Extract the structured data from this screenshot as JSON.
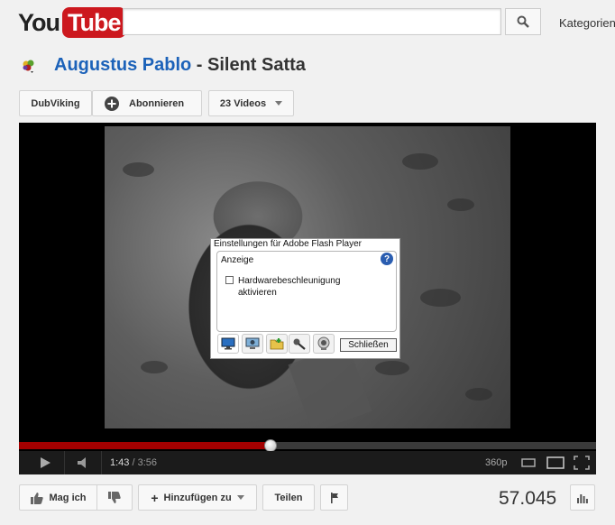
{
  "header": {
    "logo_you": "You",
    "logo_tube": "Tube",
    "search": {
      "value": "",
      "placeholder": ""
    },
    "categories_label": "Kategorien"
  },
  "video": {
    "artist": "Augustus Pablo",
    "separator": " - ",
    "song": "Silent Satta"
  },
  "channel": {
    "name_button": "DubViking",
    "subscribe_button": "Abonnieren",
    "videos_button": "23 Videos"
  },
  "player": {
    "current_time": "1:43",
    "time_separator": " / ",
    "duration": "3:56",
    "quality": "360p",
    "progress_fraction": 0.4364,
    "colors": {
      "progress": "#a30000",
      "controls_bg": "#1b1b1b"
    }
  },
  "flash_dialog": {
    "title": "Einstellungen für Adobe Flash Player",
    "section": "Anzeige",
    "checkbox_label": "Hardwarebeschleunigung aktivieren",
    "checkbox_checked": false,
    "help_glyph": "?",
    "close_button": "Schließen",
    "tabs": [
      "monitor-icon",
      "camera-display-icon",
      "folder-icon",
      "microphone-icon",
      "webcam-icon"
    ]
  },
  "actions": {
    "like": "Mag ich",
    "add_to": "Hinzufügen zu",
    "share": "Teilen",
    "view_count": "57.045"
  },
  "colors": {
    "brand_red": "#cc181e",
    "link_blue": "#1c62b9"
  }
}
